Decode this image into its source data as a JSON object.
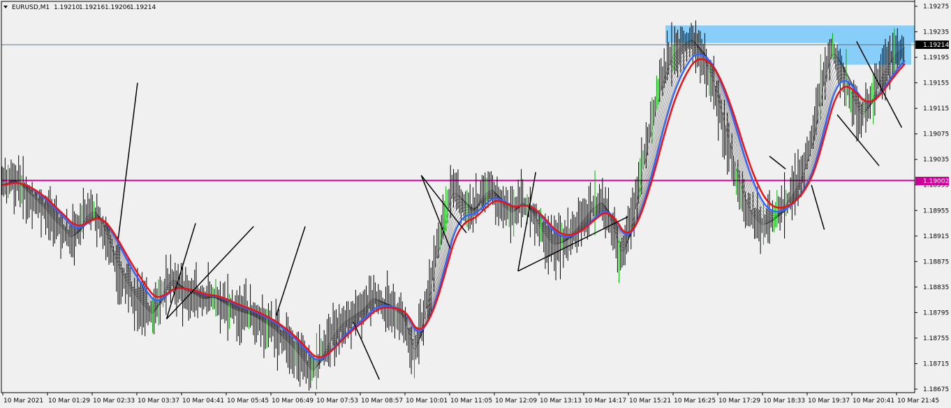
{
  "header": {
    "symbol": "EURUSD,M1",
    "bid": "1.19210",
    "high": "1.19216",
    "low": "1.19206",
    "close": "1.19214",
    "menu_icon": "triangle-down-icon"
  },
  "colors": {
    "background": "#f0f0f0",
    "candle": "#000000",
    "bull_candle": "#00aa00",
    "ema_fast": "#3366ff",
    "ema_slow": "#ee1111",
    "ema_ribbon": "#333333",
    "level_line": "#cc0099",
    "current_price_line": "#607080",
    "zone": "#87cefa",
    "trendline": "#000000"
  },
  "current_price_label": "1.19214",
  "level_label": "1.19002",
  "chart_data": {
    "type": "candlestick",
    "symbol": "EURUSD",
    "timeframe": "M1",
    "ylim": [
      1.18655,
      1.19285
    ],
    "y_ticks": [
      "1.19275",
      "1.19235",
      "1.19195",
      "1.19155",
      "1.19115",
      "1.19075",
      "1.19035",
      "1.18995",
      "1.18955",
      "1.18915",
      "1.18875",
      "1.18835",
      "1.18795",
      "1.18755",
      "1.18715",
      "1.18675"
    ],
    "x_ticks": [
      "10 Mar 2021",
      "10 Mar 01:29",
      "10 Mar 02:33",
      "10 Mar 03:37",
      "10 Mar 04:41",
      "10 Mar 05:45",
      "10 Mar 06:49",
      "10 Mar 07:53",
      "10 Mar 08:57",
      "10 Mar 10:01",
      "10 Mar 11:05",
      "10 Mar 12:09",
      "10 Mar 13:13",
      "10 Mar 14:17",
      "10 Mar 15:21",
      "10 Mar 16:25",
      "10 Mar 17:29",
      "10 Mar 18:33",
      "10 Mar 19:37",
      "10 Mar 20:41",
      "10 Mar 21:45"
    ],
    "price_path": [
      [
        0,
        1.18995
      ],
      [
        5,
        1.19005
      ],
      [
        10,
        1.1899
      ],
      [
        15,
        1.18975
      ],
      [
        20,
        1.1896
      ],
      [
        25,
        1.1894
      ],
      [
        30,
        1.18925
      ],
      [
        34,
        1.1891
      ],
      [
        38,
        1.18925
      ],
      [
        42,
        1.1895
      ],
      [
        46,
        1.18955
      ],
      [
        50,
        1.1893
      ],
      [
        55,
        1.18885
      ],
      [
        60,
        1.1885
      ],
      [
        65,
        1.18825
      ],
      [
        70,
        1.18805
      ],
      [
        75,
        1.1879
      ],
      [
        80,
        1.1883
      ],
      [
        85,
        1.1885
      ],
      [
        90,
        1.1883
      ],
      [
        95,
        1.18825
      ],
      [
        100,
        1.18815
      ],
      [
        105,
        1.1882
      ],
      [
        110,
        1.1881
      ],
      [
        115,
        1.188
      ],
      [
        120,
        1.18795
      ],
      [
        125,
        1.1879
      ],
      [
        130,
        1.1878
      ],
      [
        135,
        1.1877
      ],
      [
        140,
        1.18755
      ],
      [
        145,
        1.1874
      ],
      [
        150,
        1.1872
      ],
      [
        155,
        1.187
      ],
      [
        160,
        1.1873
      ],
      [
        165,
        1.1876
      ],
      [
        170,
        1.1878
      ],
      [
        175,
        1.1879
      ],
      [
        180,
        1.188
      ],
      [
        185,
        1.1882
      ],
      [
        190,
        1.1881
      ],
      [
        195,
        1.188
      ],
      [
        200,
        1.1879
      ],
      [
        203,
        1.1876
      ],
      [
        206,
        1.18725
      ],
      [
        210,
        1.1878
      ],
      [
        215,
        1.1885
      ],
      [
        220,
        1.1893
      ],
      [
        225,
        1.1899
      ],
      [
        230,
        1.1897
      ],
      [
        235,
        1.1895
      ],
      [
        240,
        1.1898
      ],
      [
        245,
        1.1899
      ],
      [
        250,
        1.1896
      ],
      [
        255,
        1.1895
      ],
      [
        260,
        1.1897
      ],
      [
        265,
        1.1895
      ],
      [
        270,
        1.1892
      ],
      [
        275,
        1.189
      ],
      [
        280,
        1.18905
      ],
      [
        285,
        1.1892
      ],
      [
        290,
        1.1894
      ],
      [
        295,
        1.1896
      ],
      [
        300,
        1.1897
      ],
      [
        305,
        1.1893
      ],
      [
        310,
        1.1888
      ],
      [
        315,
        1.1894
      ],
      [
        320,
        1.1902
      ],
      [
        325,
        1.1909
      ],
      [
        330,
        1.1916
      ],
      [
        335,
        1.192
      ],
      [
        340,
        1.19215
      ],
      [
        345,
        1.19225
      ],
      [
        350,
        1.19195
      ],
      [
        355,
        1.1916
      ],
      [
        360,
        1.191
      ],
      [
        365,
        1.1904
      ],
      [
        370,
        1.1898
      ],
      [
        375,
        1.18945
      ],
      [
        380,
        1.1893
      ],
      [
        385,
        1.1894
      ],
      [
        390,
        1.1896
      ],
      [
        395,
        1.1898
      ],
      [
        400,
        1.1901
      ],
      [
        405,
        1.1906
      ],
      [
        410,
        1.1915
      ],
      [
        415,
        1.1921
      ],
      [
        420,
        1.1918
      ],
      [
        425,
        1.1913
      ],
      [
        430,
        1.191
      ],
      [
        435,
        1.1913
      ],
      [
        440,
        1.1917
      ],
      [
        445,
        1.19195
      ],
      [
        448,
        1.19205
      ],
      [
        452,
        1.19214
      ]
    ],
    "horizontal_levels": [
      {
        "label": "1.19002",
        "value": 1.19002
      },
      {
        "label": "1.19214",
        "value": 1.19214
      }
    ],
    "zones": [
      {
        "from": 1.19245,
        "to": 1.1919
      }
    ]
  }
}
